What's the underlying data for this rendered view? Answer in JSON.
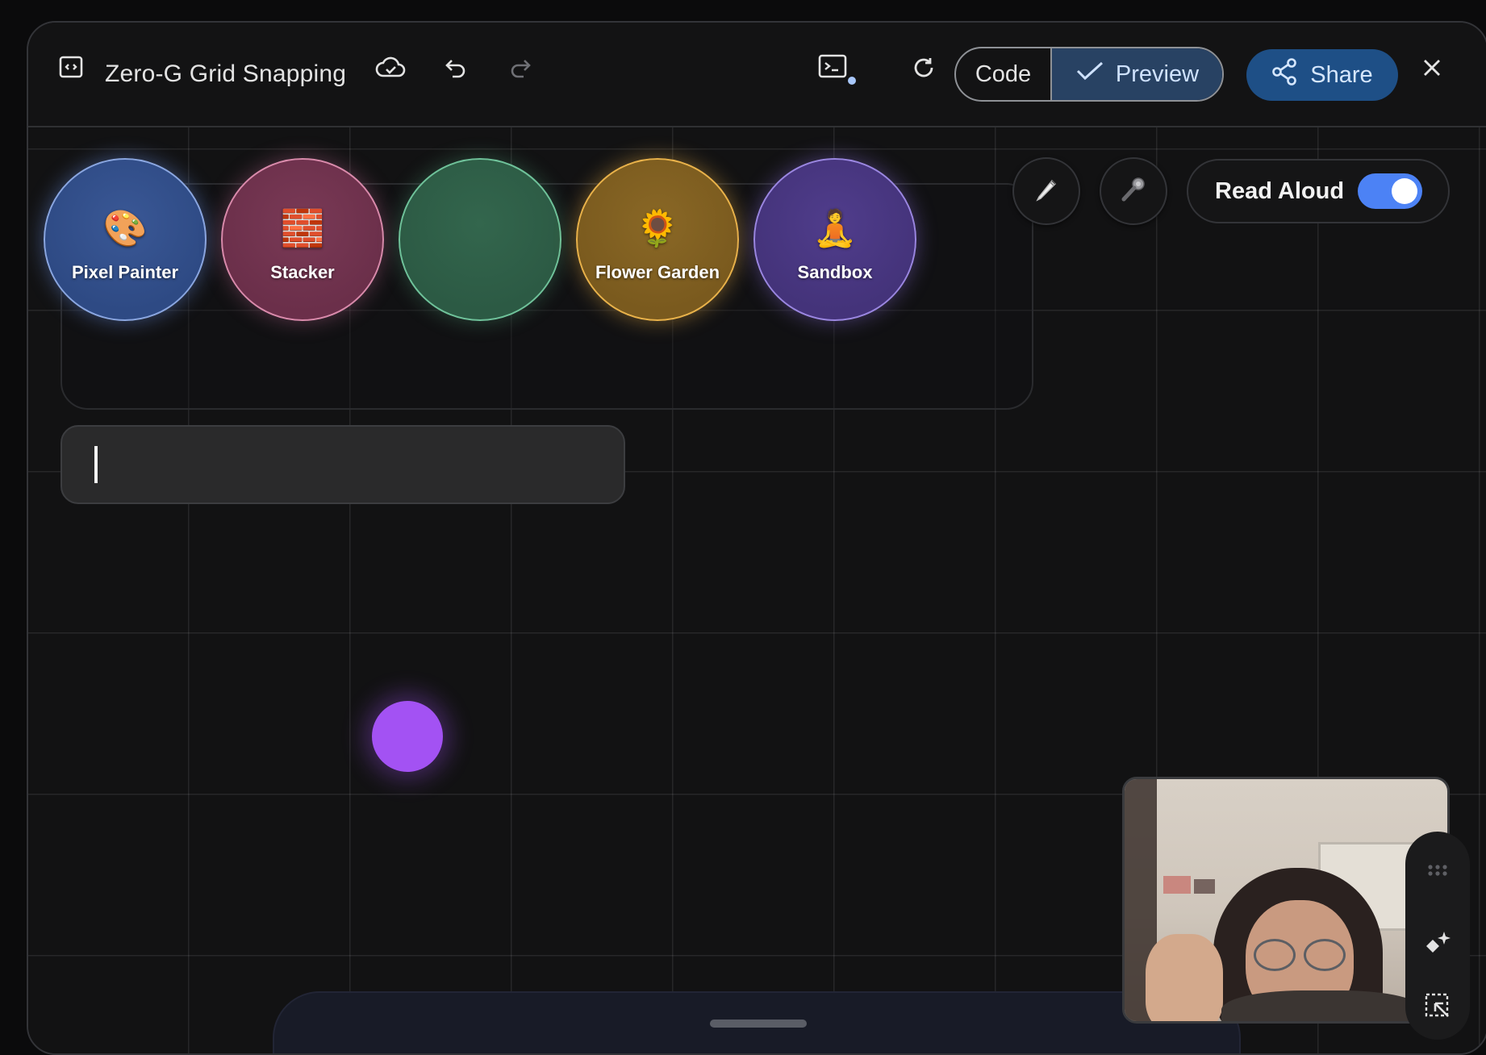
{
  "header": {
    "title": "Zero-G Grid Snapping",
    "code_label": "Code",
    "preview_label": "Preview",
    "share_label": "Share"
  },
  "launcher": {
    "items": [
      {
        "label": "Pixel Painter",
        "emoji": "🎨",
        "color": "#2e4a84"
      },
      {
        "label": "Stacker",
        "emoji": "🧱",
        "color": "#6b2f4a"
      },
      {
        "label": "",
        "emoji": "",
        "color": "#2c5a44"
      },
      {
        "label": "Flower Garden",
        "emoji": "🌻",
        "color": "#7a5a1e"
      },
      {
        "label": "Sandbox",
        "emoji": "🧘",
        "color": "#44337a"
      }
    ]
  },
  "tools": {
    "read_aloud_label": "Read Aloud",
    "read_aloud_on": true
  },
  "input": {
    "value": ""
  },
  "colors": {
    "accent": "#4c82f5",
    "share_bg": "#1e4f86",
    "preview_bg": "#284263",
    "dot": "#a352f3"
  }
}
